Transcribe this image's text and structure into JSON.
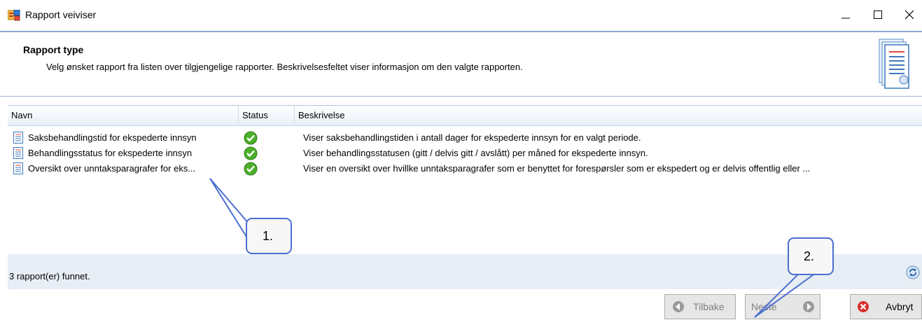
{
  "window": {
    "title": "Rapport veiviser",
    "app_icon": "report-wizard-icon",
    "controls": {
      "minimize": "minimize-icon",
      "maximize": "maximize-icon",
      "close": "close-icon"
    }
  },
  "header": {
    "title": "Rapport type",
    "description": "Velg ønsket rapport fra listen over tilgjengelige rapporter. Beskrivelsesfeltet viser informasjon om den valgte rapporten.",
    "icon": "report-document-icon"
  },
  "table": {
    "columns": [
      "Navn",
      "Status",
      "Beskrivelse"
    ],
    "rows": [
      {
        "name": "Saksbehandlingstid for ekspederte innsyn",
        "status": "ok",
        "description": "Viser saksbehandlingstiden i antall dager for ekspederte innsyn for en valgt periode."
      },
      {
        "name": "Behandlingsstatus for ekspederte innsyn",
        "status": "ok",
        "description": "Viser behandlingsstatusen (gitt / delvis gitt / avslått) per måned for ekspederte innsyn."
      },
      {
        "name": "Oversikt over unntaksparagrafer for eks...",
        "status": "ok",
        "description": "Viser en oversikt over hvillke unntaksparagrafer som er benyttet for forespørsler som er ekspedert og er delvis offentlig eller ..."
      }
    ]
  },
  "footer": {
    "found_text": "3 rapport(er) funnet.",
    "refresh_icon": "refresh-icon"
  },
  "buttons": {
    "back": "Tilbake",
    "next": "Neste",
    "cancel": "Avbryt"
  },
  "callouts": {
    "one": "1.",
    "two": "2."
  },
  "colors": {
    "accent": "#8da7cf",
    "status_ok": "#4caf2a",
    "cancel_red": "#d9302b"
  }
}
